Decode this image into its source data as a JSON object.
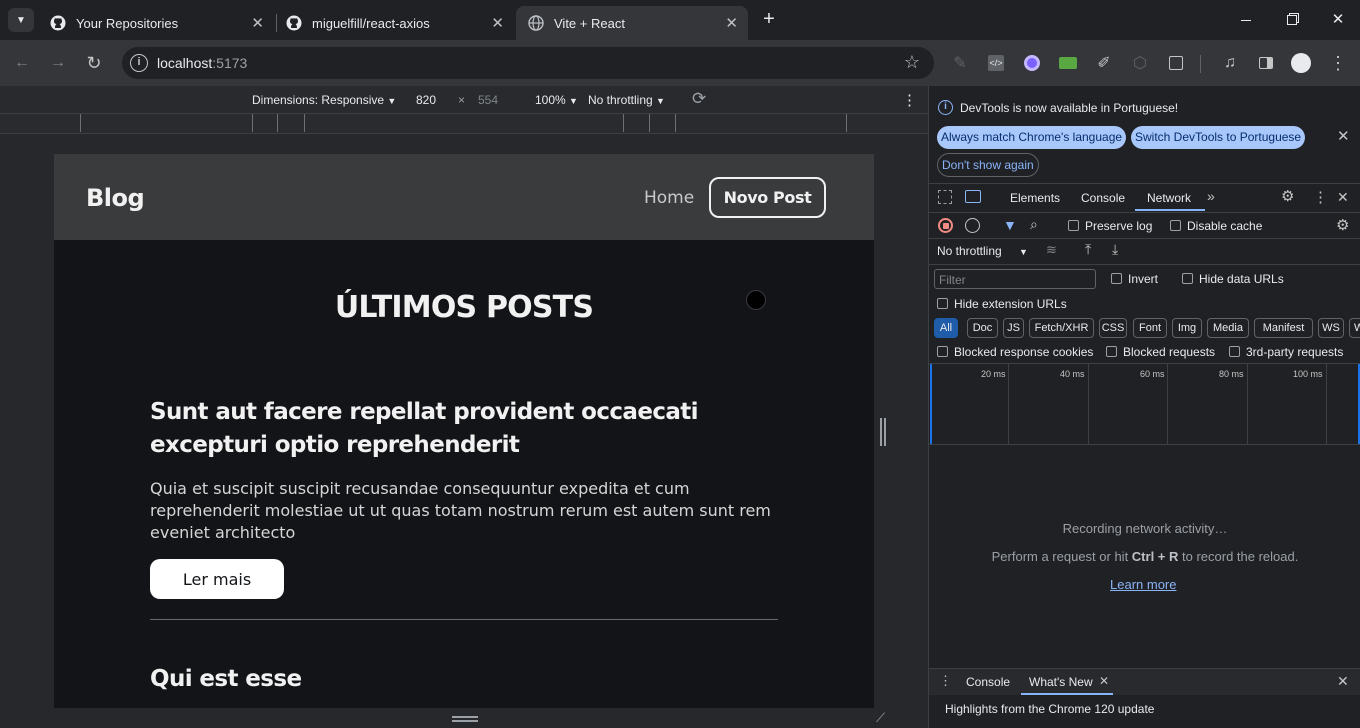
{
  "browser": {
    "tabs": [
      {
        "title": "Your Repositories",
        "icon": "github-icon"
      },
      {
        "title": "miguelfill/react-axios",
        "icon": "github-icon"
      },
      {
        "title": "Vite + React",
        "icon": "globe-icon",
        "active": true
      }
    ],
    "url_host": "localhost",
    "url_port": ":5173"
  },
  "device_toolbar": {
    "dimensions": "Dimensions: Responsive",
    "width": "820",
    "times": "×",
    "height": "554",
    "zoom": "100%",
    "throttling": "No throttling"
  },
  "page": {
    "brand": "Blog",
    "nav_home": "Home",
    "nav_new_post": "Novo Post",
    "heading": "ÚLTIMOS POSTS",
    "posts": [
      {
        "title": "Sunt aut facere repellat provident occaecati excepturi optio reprehenderit",
        "body": "Quia et suscipit suscipit recusandae consequuntur expedita et cum reprehenderit molestiae ut ut quas totam nostrum rerum est autem sunt rem eveniet architecto",
        "button": "Ler mais"
      },
      {
        "title": "Qui est esse"
      }
    ]
  },
  "devtools": {
    "info_message": "DevTools is now available in Portuguese!",
    "btn_match": "Always match Chrome's language",
    "btn_switch": "Switch DevTools to Portuguese",
    "btn_dont_show": "Don't show again",
    "tabs": [
      "Elements",
      "Console",
      "Network"
    ],
    "active_tab": "Network",
    "preserve_log": "Preserve log",
    "disable_cache": "Disable cache",
    "throttling": "No throttling",
    "filter_placeholder": "Filter",
    "invert": "Invert",
    "hide_data_urls": "Hide data URLs",
    "hide_extension_urls": "Hide extension URLs",
    "type_filters": [
      "All",
      "Doc",
      "JS",
      "Fetch/XHR",
      "CSS",
      "Font",
      "Img",
      "Media",
      "Manifest",
      "WS",
      "W"
    ],
    "blocked_cookies": "Blocked response cookies",
    "blocked_requests": "Blocked requests",
    "third_party": "3rd-party requests",
    "timeline_ticks": [
      "20 ms",
      "40 ms",
      "60 ms",
      "80 ms",
      "100 ms"
    ],
    "recording": "Recording network activity…",
    "perform_prefix": "Perform a request or hit ",
    "perform_shortcut": "Ctrl + R",
    "perform_suffix": " to record the reload.",
    "learn_more": "Learn more",
    "drawer_tabs": [
      "Console",
      "What's New"
    ],
    "drawer_active": "What's New",
    "drawer_content": "Highlights from the Chrome 120 update"
  },
  "colors": {
    "accent_blue": "#8ab4f8",
    "record_red": "#f28b82",
    "page_bg": "#121417",
    "navbar_bg": "#3a3b3d"
  }
}
